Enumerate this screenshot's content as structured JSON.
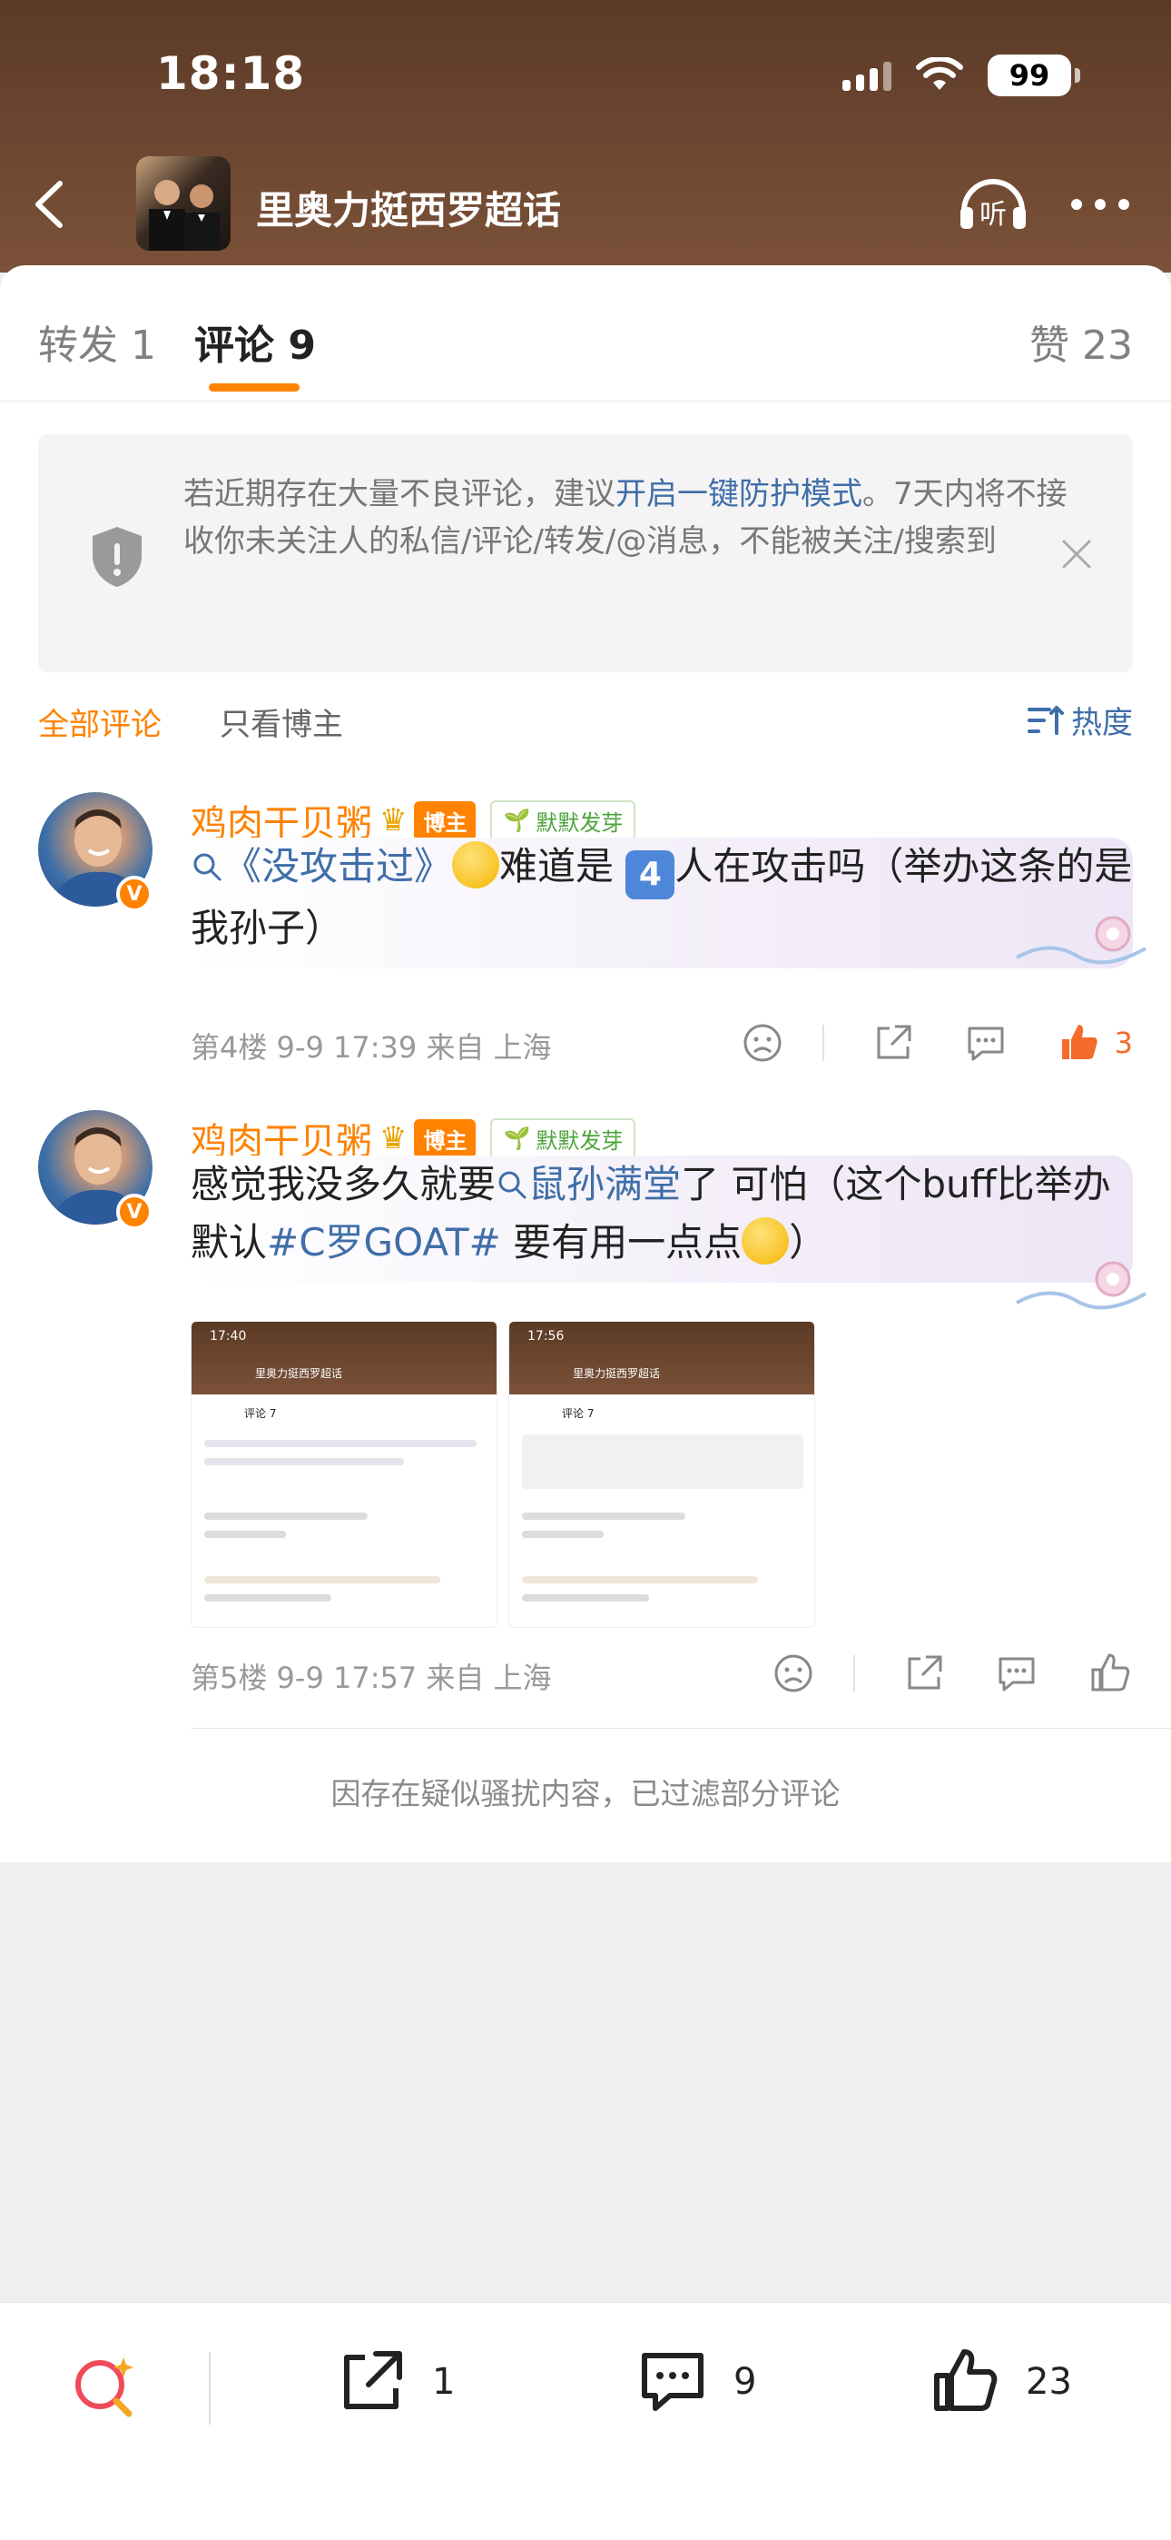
{
  "status_bar": {
    "time": "18:18",
    "battery": "99"
  },
  "header": {
    "title": "里奥力挺西罗超话"
  },
  "tabs": {
    "repost": "转发 1",
    "comments": "评论 9",
    "likes": "赞 23"
  },
  "notice": {
    "text_before": "若近期存在大量不良评论，建议",
    "link": "开启一键防护模式",
    "text_after": "。7天内将不接收你未关注人的私信/评论/转发/@消息，不能被关注/搜索到"
  },
  "filters": {
    "all": "全部评论",
    "host_only": "只看博主",
    "sort": "热度"
  },
  "comments": [
    {
      "username": "鸡肉干贝粥",
      "host_badge": "博主",
      "sprout_badge": "默默发芽",
      "topic": "《没攻击过》",
      "text_mid": "难道是",
      "key_number": "4",
      "text_end": "人在攻击吗（举办这条的是我孙子）",
      "meta": "第4楼 9-9 17:39 来自 上海",
      "likes": "3"
    },
    {
      "username": "鸡肉干贝粥",
      "host_badge": "博主",
      "sprout_badge": "默默发芽",
      "text_start": "感觉我没多久就要",
      "topic": "鼠孙满堂",
      "text_mid": "了 可怕（这个buff比举办默认",
      "hashtag": "#C罗GOAT#",
      "text_end": "要有用一点点",
      "text_close": "）",
      "meta": "第5楼 9-9 17:57 来自 上海",
      "thumbnails": [
        {
          "time": "17:40",
          "title": "里奥力挺西罗超话",
          "tab": "评论 7"
        },
        {
          "time": "17:56",
          "title": "里奥力挺西罗超话",
          "tab": "评论 7"
        }
      ]
    }
  ],
  "filtered_note": "因存在疑似骚扰内容，已过滤部分评论",
  "bottom_bar": {
    "repost_count": "1",
    "comment_count": "9",
    "like_count": "23"
  },
  "colors": {
    "accent": "#ff8200",
    "link": "#3f6ea8",
    "header": "#6b4530"
  }
}
